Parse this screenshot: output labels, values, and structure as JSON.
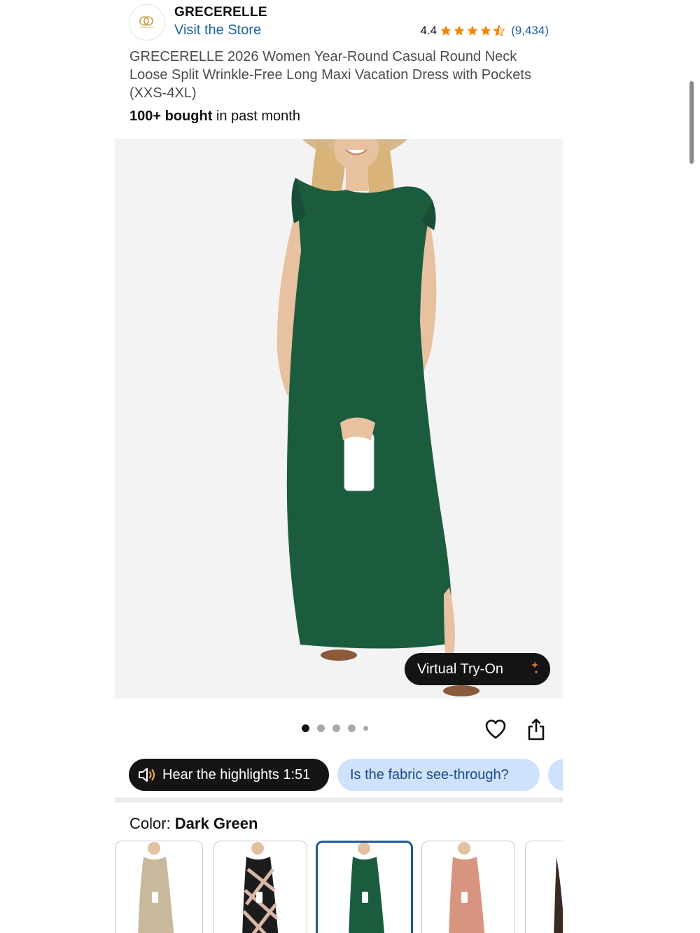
{
  "store": {
    "logo_icon": "store-logo-icon",
    "brand": "GRECERELLE",
    "visit_label": "Visit the Store"
  },
  "rating": {
    "value": "4.4",
    "stars": 4.4,
    "star_color": "#f08804",
    "reviews": "(9,434)"
  },
  "product": {
    "title": "GRECERELLE 2026 Women Year-Round Casual Round Neck Loose Split Wrinkle-Free Long Maxi Vacation Dress with Pockets (XXS-4XL)",
    "bought_bold": "100+ bought",
    "bought_rest": " in past month"
  },
  "gallery": {
    "image_icon": "dress-photo",
    "virtual_tryon_label": "Virtual Try-On",
    "dot_count": 5,
    "active_dot": 0
  },
  "actions": {
    "wishlist_icon": "heart-icon",
    "share_icon": "share-icon"
  },
  "chips": {
    "audio_label": "Hear the highlights 1:51",
    "question_1": "Is the fabric see-through?",
    "question_2": ""
  },
  "color": {
    "label": "Color: ",
    "selected": "Dark Green",
    "swatches": [
      {
        "name": "khaki",
        "hex": "#c8b89c"
      },
      {
        "name": "black-pattern",
        "hex": "#1c1c1c"
      },
      {
        "name": "dark-green",
        "hex": "#1b5c3e"
      },
      {
        "name": "pink",
        "hex": "#d7957f"
      },
      {
        "name": "brown",
        "hex": "#3a2a22"
      }
    ],
    "selected_index": 2
  },
  "colors": {
    "link": "#2162a1",
    "chip_bg": "#cfe2fb",
    "dark_pill": "#141414",
    "dress_green": "#1b5c3e"
  }
}
